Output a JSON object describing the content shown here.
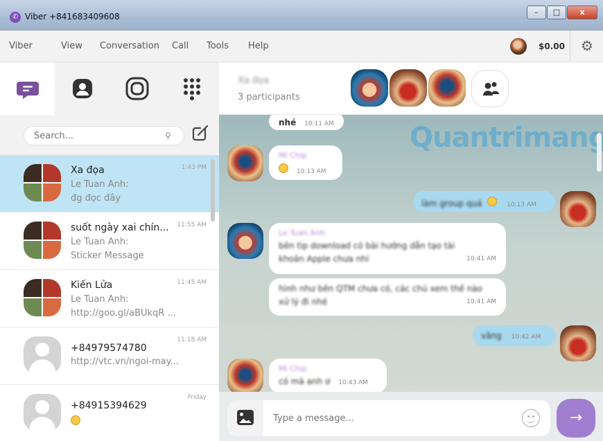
{
  "window": {
    "title": "Viber +841683409608",
    "controls": {
      "minimize": "–",
      "maximize": "□",
      "close": "x"
    }
  },
  "menu": {
    "items": [
      "Viber",
      "View",
      "Conversation",
      "Call",
      "Tools",
      "Help"
    ],
    "balance": "$0.00"
  },
  "sidebar": {
    "tabs": [
      "chats-icon",
      "contacts-icon",
      "public-chats-icon",
      "dialpad-icon"
    ],
    "accent": "#7b519d",
    "search": {
      "placeholder": "Search..."
    },
    "chats": [
      {
        "name": "Xa đọa",
        "sender": "Le Tuan Anh:",
        "preview": "đg đọc đây",
        "time": "1:43 PM",
        "active": true
      },
      {
        "name": "suốt ngày xai chín...",
        "sender": "Le Tuan Anh:",
        "preview": "Sticker Message",
        "time": "11:55 AM"
      },
      {
        "name": "Kiến Lửa",
        "sender": "Le Tuan Anh:",
        "preview": "http://goo.gl/aBUkqR ...",
        "time": "11:45 AM"
      },
      {
        "name": "+84979574780",
        "preview": "http://vtc.vn/ngoi-may...",
        "time": "11:18 AM"
      },
      {
        "name": "+84915394629",
        "time": "Friday"
      }
    ]
  },
  "conversation": {
    "name": "Xa đọa",
    "participants": "3 participants",
    "watermark": "Quantrimang",
    "messages": [
      {
        "text": "nhé",
        "time": "10:11 AM"
      },
      {
        "sender": "Mi Chip",
        "time": "10:13 AM"
      },
      {
        "text": "làm group quả",
        "time": "10:13 AM"
      },
      {
        "sender": "Le Tuan Anh",
        "text": "bên tip download có bài hướng dẫn tạo tài",
        "text2": "khoản Apple chưa nhỉ",
        "time": "10:41 AM"
      },
      {
        "text": "hình như bên QTM chưa có, các chú xem thế nào",
        "text2": "xử lý đi nhé",
        "time": "10:41 AM"
      },
      {
        "text": "vâng",
        "time": "10:42 AM"
      },
      {
        "sender": "Mi Chip",
        "text": "có mà anh ơ",
        "time": "10:43 AM"
      }
    ]
  },
  "composer": {
    "placeholder": "Type a message...",
    "send": "→"
  }
}
